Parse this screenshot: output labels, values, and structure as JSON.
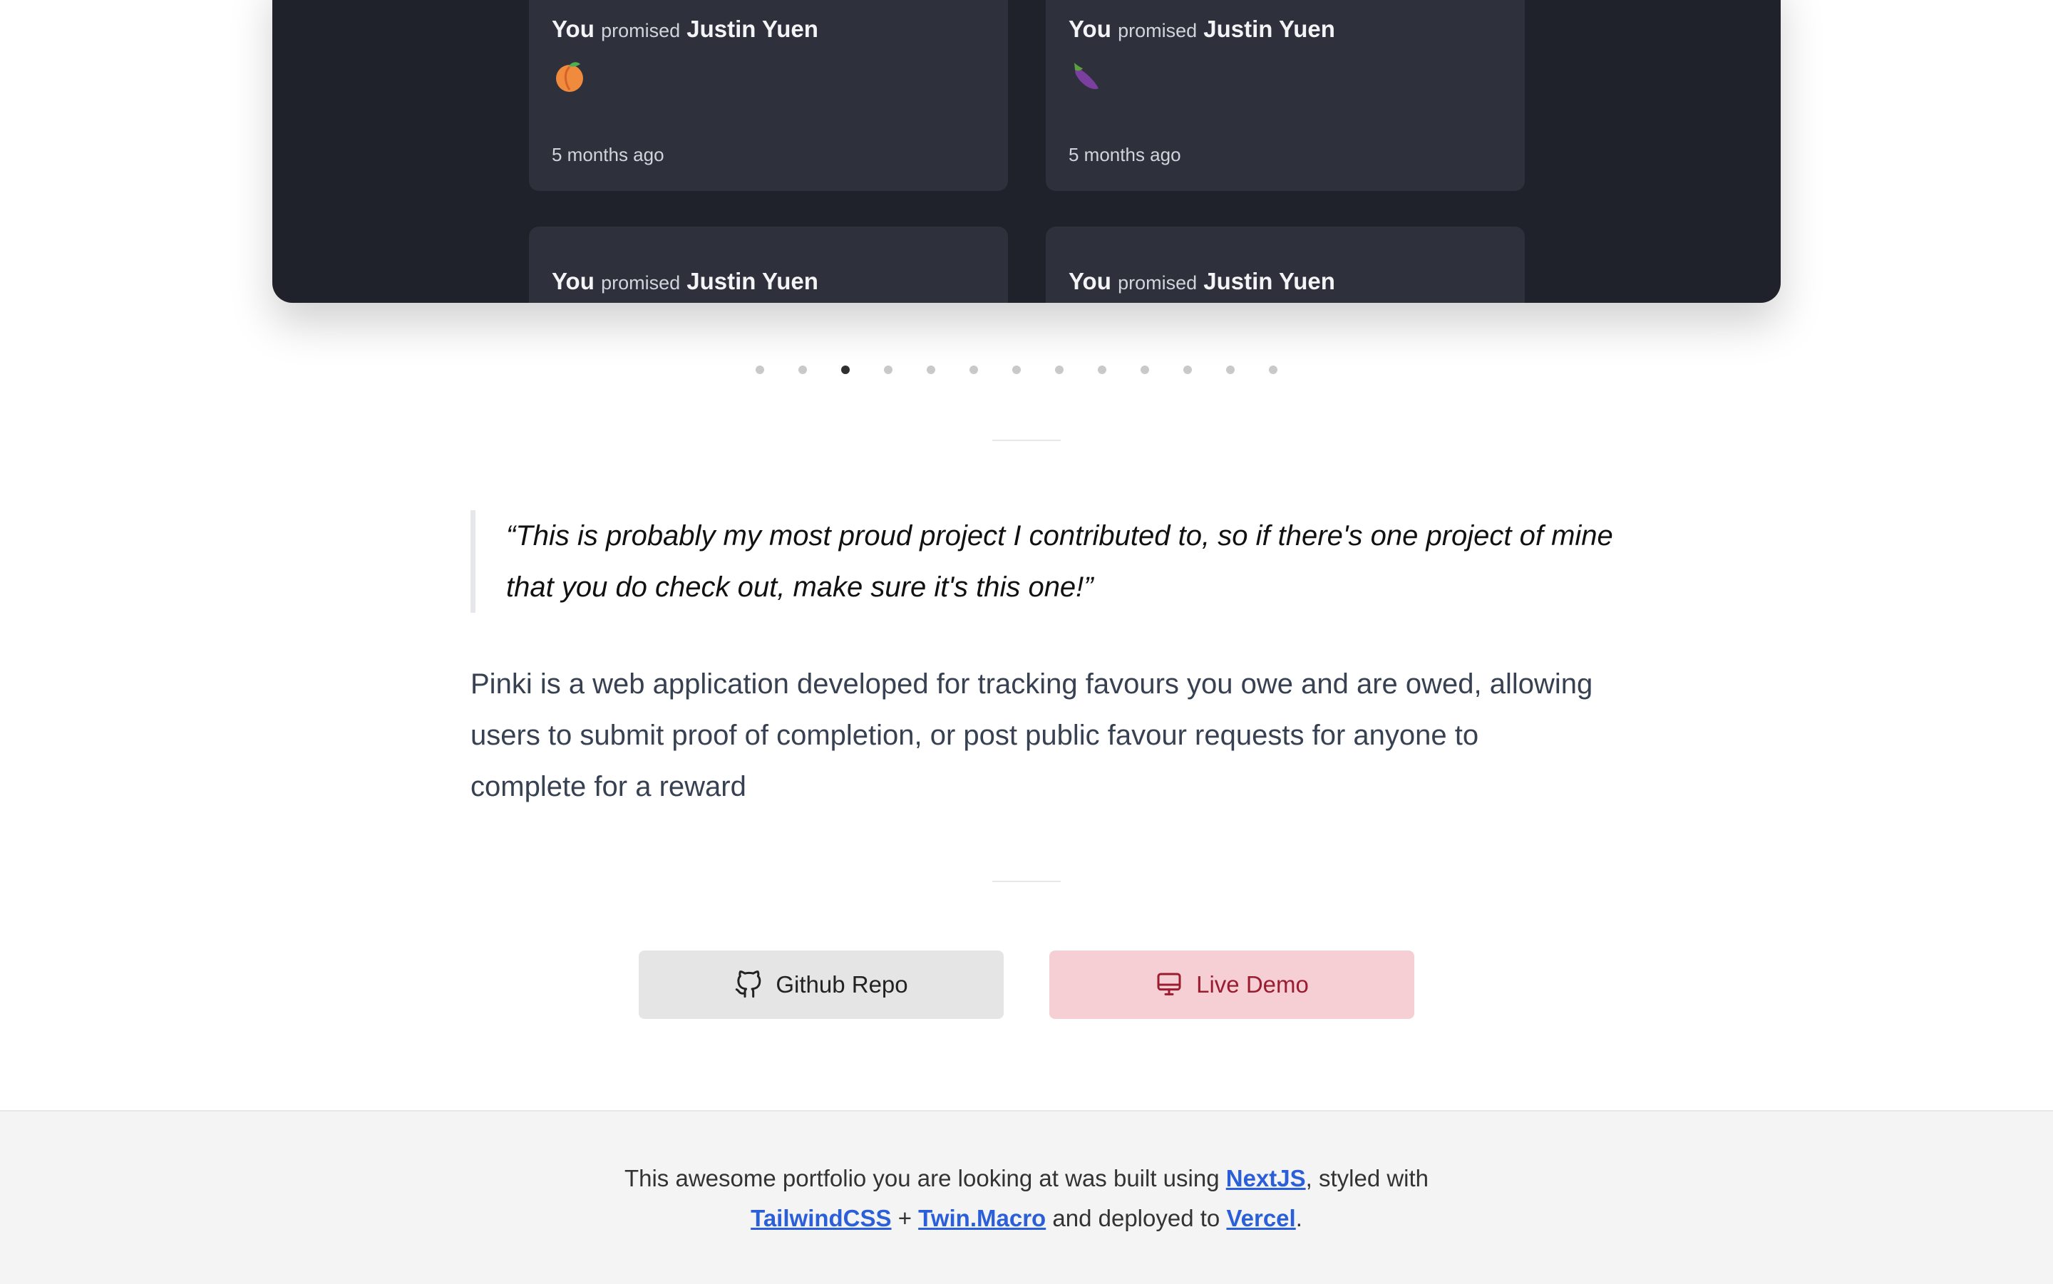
{
  "slide": {
    "cards": [
      {
        "subject": "You",
        "verb": "promised",
        "target": "Justin Yuen",
        "emoji": "peach-emoji",
        "time": "5 months ago"
      },
      {
        "subject": "You",
        "verb": "promised",
        "target": "Justin Yuen",
        "emoji": "eggplant-emoji",
        "time": "5 months ago"
      },
      {
        "subject": "You",
        "verb": "promised",
        "target": "Justin Yuen",
        "emoji": "",
        "time": ""
      },
      {
        "subject": "You",
        "verb": "promised",
        "target": "Justin Yuen",
        "emoji": "",
        "time": ""
      }
    ]
  },
  "pagination": {
    "count": 13,
    "active_index": 2
  },
  "quote": "“This is probably my most proud project I contributed to, so if there's one project of mine that you do check out, make sure it's this one!”",
  "description": "Pinki is a web application developed for tracking favours you owe and are owed, allowing users to submit proof of completion, or post public favour requests for anyone to complete for a reward",
  "buttons": {
    "github": {
      "label": "Github Repo",
      "icon": "github-icon"
    },
    "demo": {
      "label": "Live Demo",
      "icon": "monitor-icon"
    }
  },
  "footer": {
    "part1": "This awesome portfolio you are looking at was built using ",
    "link_nextjs": "NextJS",
    "part2": ", styled with ",
    "link_tailwind": "TailwindCSS",
    "part3": " + ",
    "link_twin": "Twin.Macro",
    "part4": " and deployed to ",
    "link_vercel": "Vercel",
    "part5": "."
  },
  "colors": {
    "slide_bg": "#1f212b",
    "card_bg": "#2e303b",
    "github_button_bg": "#e5e5e5",
    "demo_button_bg": "#f5cfd4",
    "demo_button_text": "#9b1c30",
    "link": "#2b5fd9",
    "footer_bg": "#f4f4f4"
  }
}
